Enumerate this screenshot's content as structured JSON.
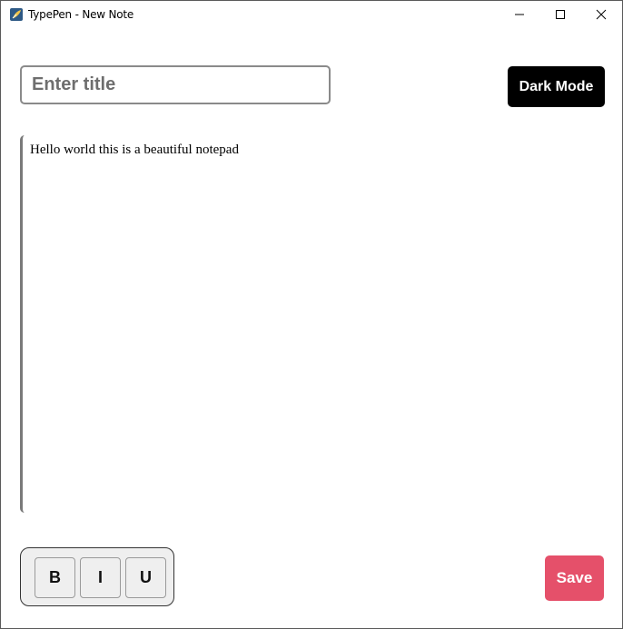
{
  "window": {
    "title": "TypePen - New Note",
    "app_icon": "python-feather-icon",
    "controls": {
      "minimize_icon": "minimize-icon",
      "maximize_icon": "maximize-icon",
      "close_icon": "close-icon"
    }
  },
  "header": {
    "title_input": {
      "value": "",
      "placeholder": "Enter title"
    },
    "dark_mode_label": "Dark Mode"
  },
  "editor": {
    "content": "Hello world this is a beautiful notepad"
  },
  "format_toolbar": {
    "bold_label": "B",
    "italic_label": "I",
    "underline_label": "U"
  },
  "actions": {
    "save_label": "Save"
  },
  "colors": {
    "save_button": "#e5506a",
    "dark_mode_button": "#000000",
    "toolbar_background": "#efefef"
  }
}
